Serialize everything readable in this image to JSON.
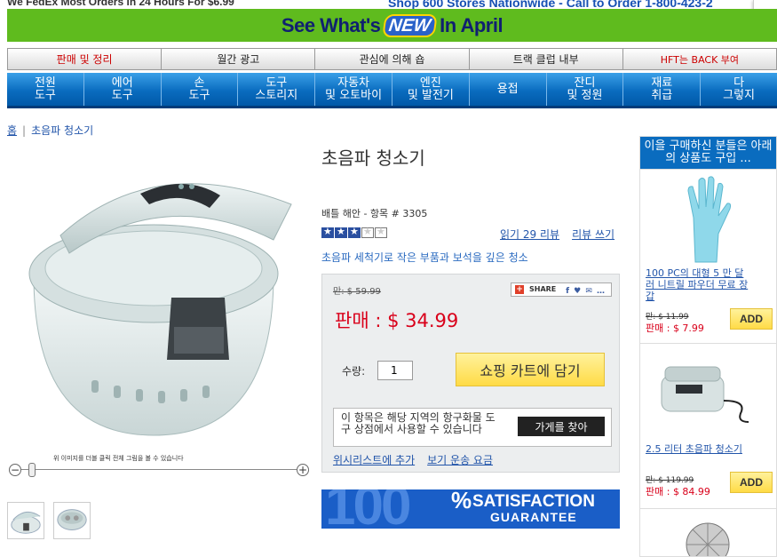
{
  "topbar": {
    "left": "We FedEx Most Orders in 24 Hours For $6.99",
    "right": "Shop 600 Stores Nationwide - Call to Order 1-800-423-2"
  },
  "banner": {
    "pre": "See What's",
    "new": "NEW",
    "post": "In April"
  },
  "categories": [
    "판매 및 정리",
    "월간 광고",
    "관심에 의해 숍",
    "트랙 클럽 내부",
    "HFT는 BACK 부여"
  ],
  "nav": [
    "전원\n도구",
    "에어\n도구",
    "손\n도구",
    "도구\n스토리지",
    "자동차\n및 오토바이",
    "엔진\n및 발전기",
    "용접",
    "잔디\n및 정원",
    "재료\n취급",
    "다\n그렇지"
  ],
  "breadcrumb": {
    "home": "홈",
    "current": "초음파 청소기"
  },
  "product": {
    "title": "초음파 청소기",
    "brand": "배틀 해안 - 항목 # 3305",
    "rating": 3,
    "rating_max": 5,
    "read_reviews": "읽기 29 리뷰",
    "write_review": "리뷰 쓰기",
    "tagline": "초음파 세척기로 작은 부품과 보석을 깊은 청소",
    "old_price": "만: $ 59.99",
    "share": "SHARE",
    "sale_price": "판매 : $ 34.99",
    "qty_label": "수량:",
    "qty": "1",
    "add_to_cart": "쇼핑 카트에 담기",
    "store_text": "이 항목은 해당 지역의 항구화물 도구 상점에서 사용할 수 있습니다",
    "find_store": "가게를 찾아",
    "wishlist": "위시리스트에 추가",
    "shipping": "보기 운송 요금",
    "zoom_hint": "위 이미지를 더블 클릭 전체 그림을 볼 수 있습니다"
  },
  "guarantee": {
    "num": "100",
    "pct": "%",
    "line1": "SATISFACTION",
    "line2": "GUARANTEE"
  },
  "sidebar": {
    "header": "이을 구매하신 분들은 아래의 상품도 구입 ...",
    "items": [
      {
        "name": "100 PC의 대형 5 만 달러 니트릴 파우더 무료 장갑",
        "was": "만: $ 11.99",
        "now": "판매 : $ 7.99",
        "add": "ADD"
      },
      {
        "name": "2.5 리터 초음파 청소기",
        "was": "만: $ 119.99",
        "now": "판매 : $ 84.99",
        "add": "ADD"
      }
    ]
  },
  "colors": {
    "accent": "#0a6cbf",
    "banner": "#5fbb1e",
    "sale": "#d9001a",
    "button": "#ffdb46"
  }
}
